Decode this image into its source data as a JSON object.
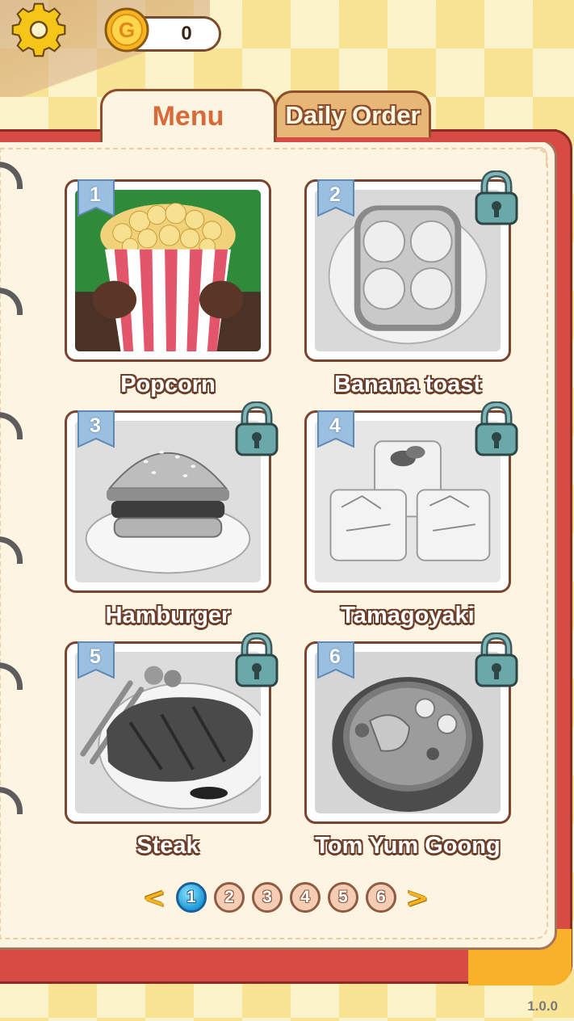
{
  "hud": {
    "settings_icon": "gear-icon",
    "coin_icon": "gold-coin-icon",
    "coin_letter": "G",
    "coin_count": "0"
  },
  "tabs": [
    {
      "label": "Menu",
      "active": true
    },
    {
      "label": "Daily Order",
      "active": false
    }
  ],
  "dishes": [
    {
      "number": "1",
      "name": "Popcorn",
      "locked": false
    },
    {
      "number": "2",
      "name": "Banana toast",
      "locked": true
    },
    {
      "number": "3",
      "name": "Hamburger",
      "locked": true
    },
    {
      "number": "4",
      "name": "Tamagoyaki",
      "locked": true
    },
    {
      "number": "5",
      "name": "Steak",
      "locked": true
    },
    {
      "number": "6",
      "name": "Tom Yum Goong",
      "locked": true
    }
  ],
  "pagination": {
    "prev": "<",
    "next": ">",
    "pages": [
      "1",
      "2",
      "3",
      "4",
      "5",
      "6"
    ],
    "current": "1"
  },
  "version": "1.0.0",
  "colors": {
    "accent_red": "#d84a44",
    "accent_gold": "#f7b22a",
    "tab_text": "#d86a3a",
    "active_page": "#1f9ad8"
  }
}
